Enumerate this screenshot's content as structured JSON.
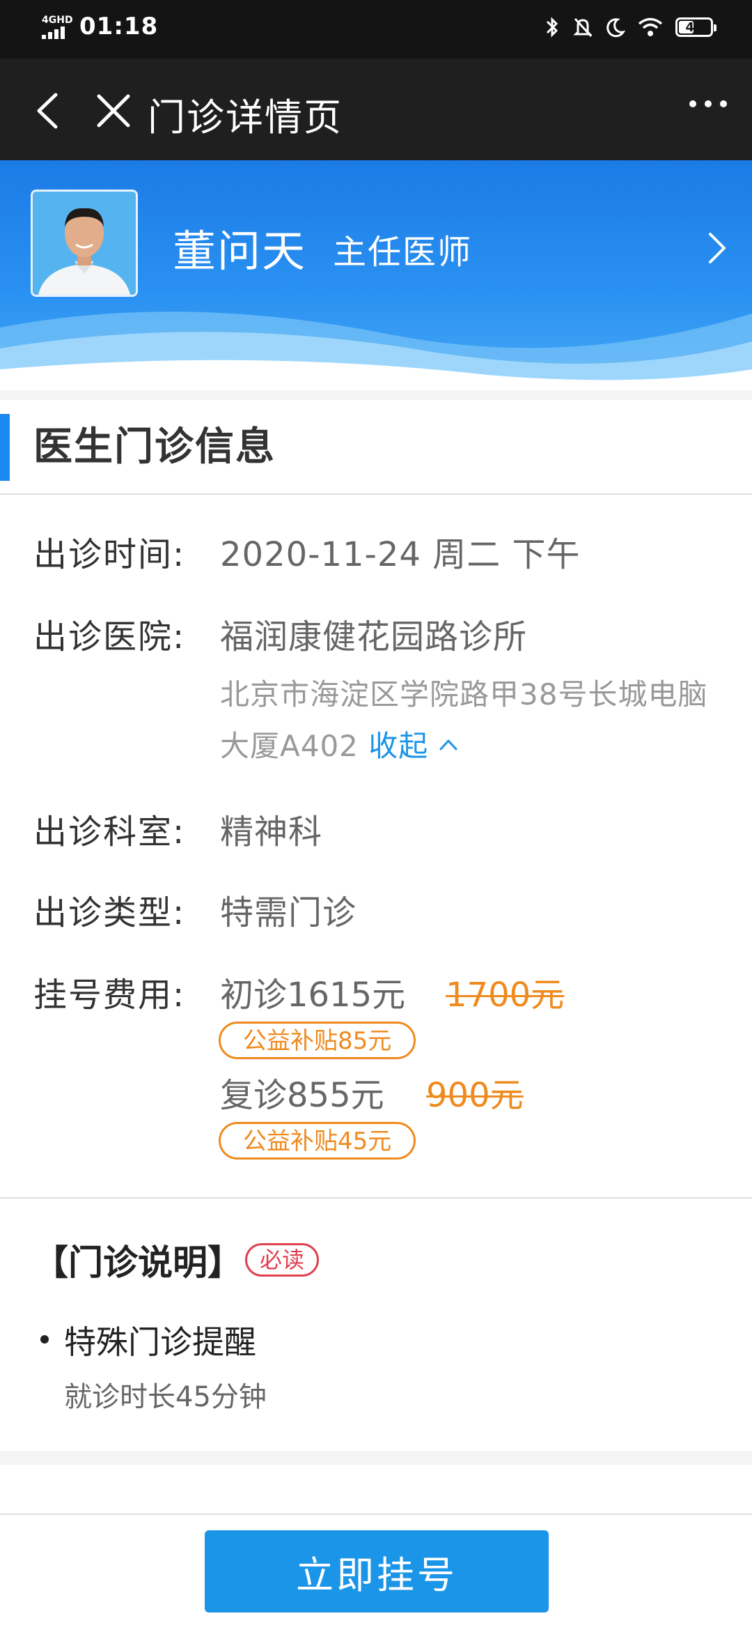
{
  "status_bar": {
    "network": "4GHD",
    "time": "01:18",
    "battery": "48"
  },
  "nav": {
    "title": "门诊详情页"
  },
  "doctor": {
    "name": "董问天",
    "title": "主任医师"
  },
  "section": {
    "title": "医生门诊信息"
  },
  "info": {
    "time_label": "出诊时间:",
    "time_value": "2020-11-24 周二 下午",
    "hospital_label": "出诊医院:",
    "hospital_value": "福润康健花园路诊所",
    "address": "北京市海淀区学院路甲38号长城电脑大厦A402",
    "collapse_label": "收起",
    "dept_label": "出诊科室:",
    "dept_value": "精神科",
    "type_label": "出诊类型:",
    "type_value": "特需门诊",
    "fee_label": "挂号费用:",
    "first_visit": "初诊1615元",
    "first_visit_original": "1700元",
    "first_subsidy": "公益补贴85元",
    "followup_visit": "复诊855元",
    "followup_original": "900元",
    "followup_subsidy": "公益补贴45元"
  },
  "notes": {
    "title": "【门诊说明】",
    "badge": "必读",
    "item_title": "特殊门诊提醒",
    "item_desc": "就诊时长45分钟"
  },
  "footer": {
    "book_button": "立即挂号"
  },
  "colors": {
    "accent": "#1b95e8",
    "price_old": "#ef8a1e",
    "must_read": "#e0404f"
  }
}
